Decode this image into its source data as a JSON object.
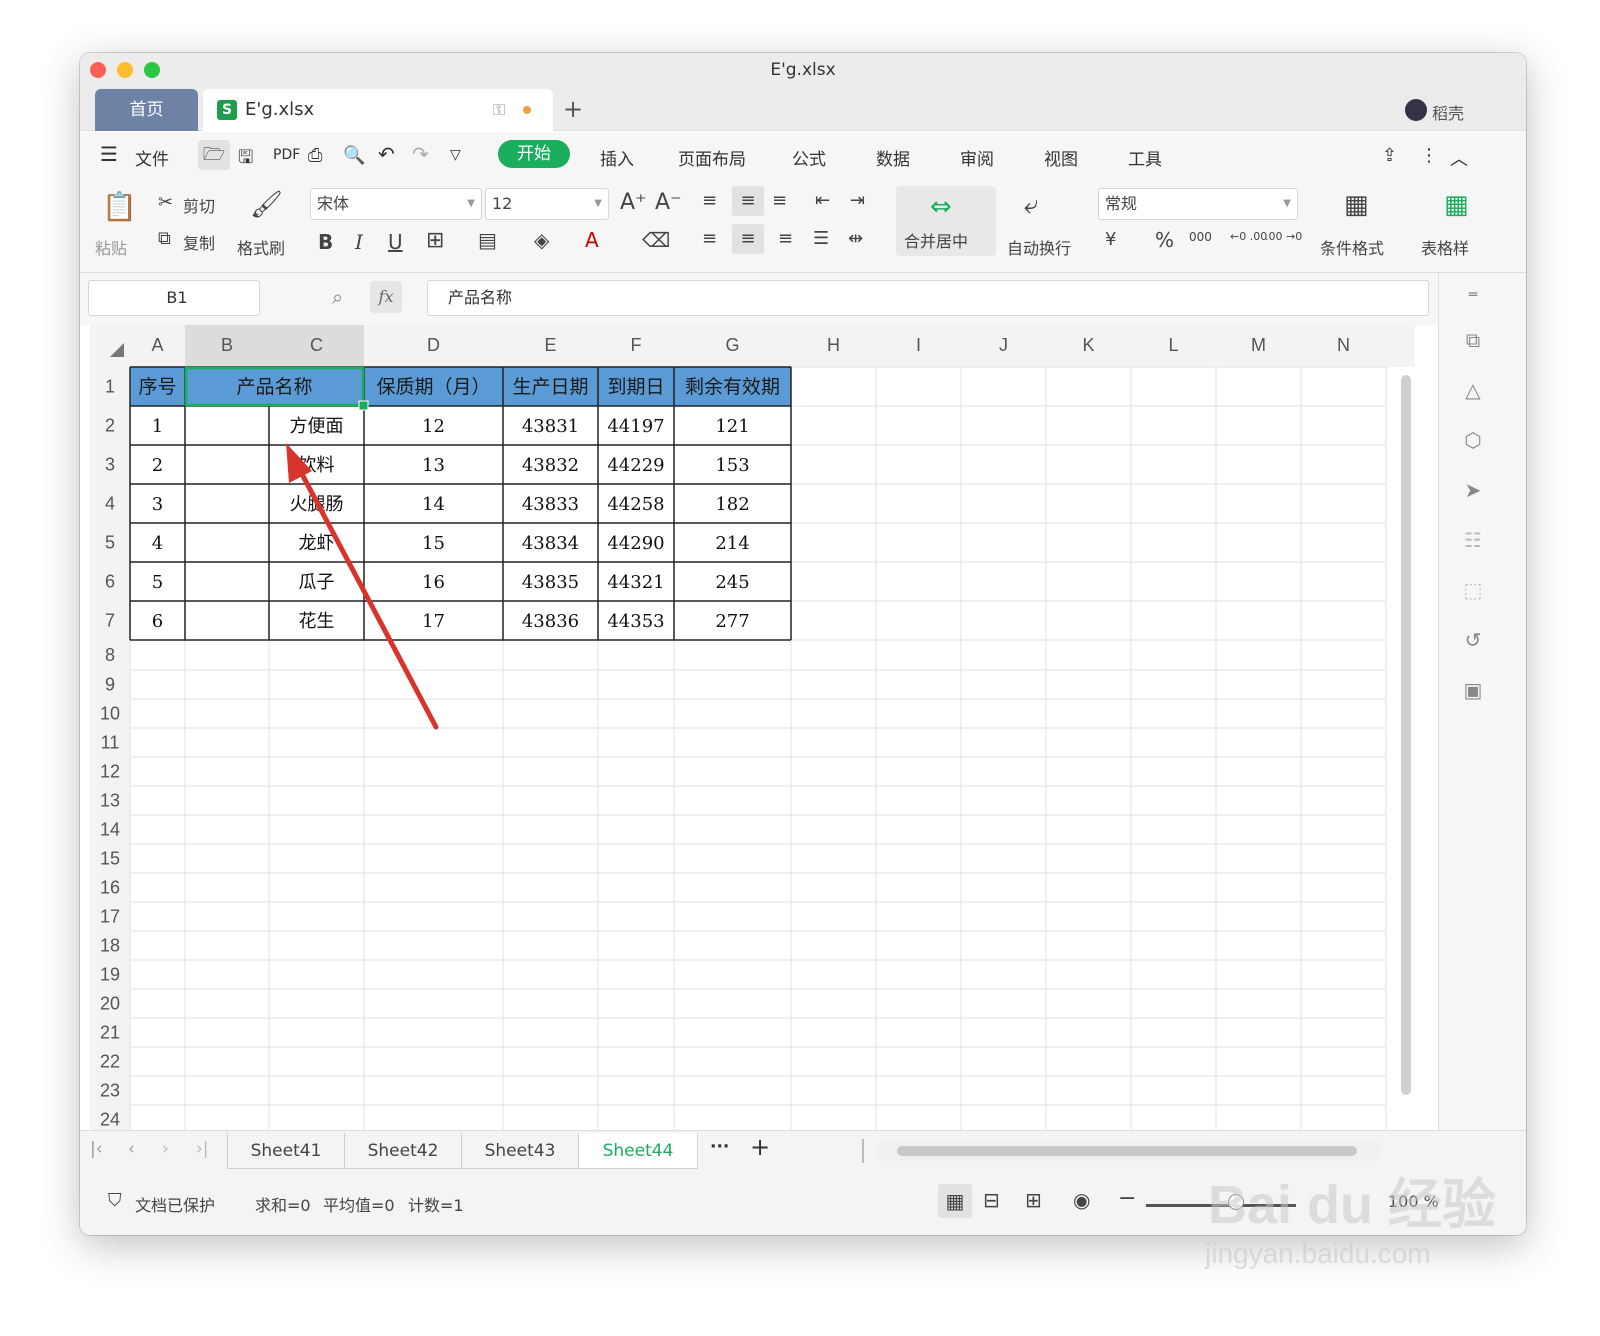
{
  "window": {
    "title": "E'g.xlsx"
  },
  "tabs": {
    "home": "首页",
    "file": "E'g.xlsx",
    "user": "稻壳",
    "add": "+"
  },
  "menu": {
    "file": "文件",
    "items": [
      "开始",
      "插入",
      "页面布局",
      "公式",
      "数据",
      "审阅",
      "视图",
      "工具"
    ]
  },
  "ribbon": {
    "paste": "粘贴",
    "cut": "剪切",
    "copy": "复制",
    "format_painter": "格式刷",
    "font": "宋体",
    "size": "12",
    "merge": "合并居中",
    "wrap": "自动换行",
    "numfmt": "常规",
    "cond": "条件格式",
    "table": "表格样",
    "percent": "%",
    "thousands": "000",
    "dec_inc": "←0 .00",
    "dec_dec": ".00 →0"
  },
  "formula": {
    "cell_ref": "B1",
    "fx": "fx",
    "content": "产品名称"
  },
  "columns": [
    "A",
    "B",
    "C",
    "D",
    "E",
    "F",
    "G",
    "H",
    "I",
    "J",
    "K",
    "L",
    "M",
    "N"
  ],
  "rows": [
    "1",
    "2",
    "3",
    "4",
    "5",
    "6",
    "7",
    "8",
    "9",
    "10",
    "11",
    "12",
    "13",
    "14",
    "15",
    "16",
    "17",
    "18",
    "19",
    "20",
    "21",
    "22",
    "23",
    "24"
  ],
  "table": {
    "headers": [
      "序号",
      "产品名称",
      "保质期（月）",
      "生产日期",
      "到期日",
      "剩余有效期"
    ],
    "data": [
      [
        "1",
        "方便面",
        "12",
        "43831",
        "44197",
        "121"
      ],
      [
        "2",
        "饮料",
        "13",
        "43832",
        "44229",
        "153"
      ],
      [
        "3",
        "火腿肠",
        "14",
        "43833",
        "44258",
        "182"
      ],
      [
        "4",
        "龙虾",
        "15",
        "43834",
        "44290",
        "214"
      ],
      [
        "5",
        "瓜子",
        "16",
        "43835",
        "44321",
        "245"
      ],
      [
        "6",
        "花生",
        "17",
        "43836",
        "44353",
        "277"
      ]
    ]
  },
  "sheets": [
    "Sheet41",
    "Sheet42",
    "Sheet43",
    "Sheet44"
  ],
  "active_sheet": "Sheet44",
  "sheet_more": "···",
  "sheet_add": "+",
  "status": {
    "protect": "文档已保护",
    "sum": "求和=0",
    "avg": "平均值=0",
    "count": "计数=1",
    "zoom": "100 %"
  },
  "watermark": {
    "brand": "Bai du 经验",
    "url": "jingyan.baidu.com"
  },
  "colors": {
    "header_fill": "#5b9bd5",
    "active_green": "#1aad5c",
    "arrow": "#d9342b"
  }
}
